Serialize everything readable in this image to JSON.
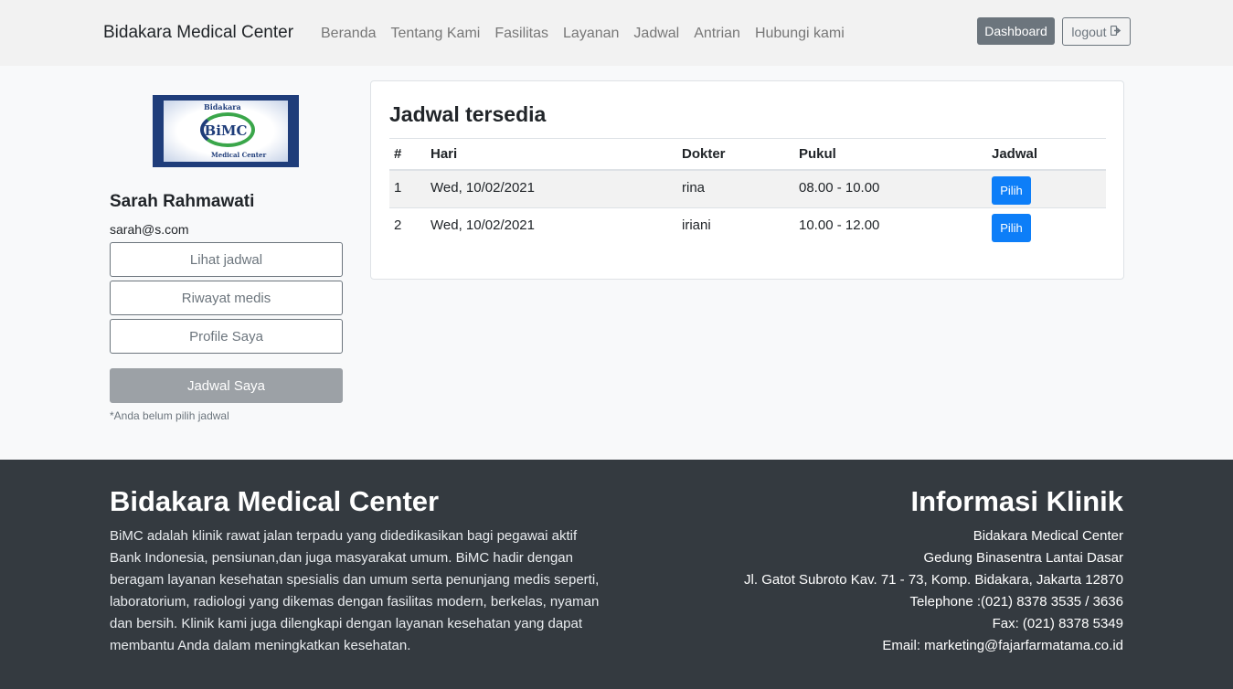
{
  "navbar": {
    "brand": "Bidakara Medical Center",
    "links": [
      "Beranda",
      "Tentang Kami",
      "Fasilitas",
      "Layanan",
      "Jadwal",
      "Antrian",
      "Hubungi kami"
    ],
    "dashboard_label": "Dashboard",
    "logout_label": "logout"
  },
  "logo": {
    "top_text": "Bidakara",
    "mark_text": "BiMC",
    "bottom_text": "Medical Center"
  },
  "sidebar": {
    "user_name": "Sarah Rahmawati",
    "user_email": "sarah@s.com",
    "buttons": [
      "Lihat jadwal",
      "Riwayat medis",
      "Profile Saya"
    ],
    "my_schedule_label": "Jadwal Saya",
    "note": "*Anda belum pilih jadwal"
  },
  "schedule": {
    "title": "Jadwal tersedia",
    "headers": [
      "#",
      "Hari",
      "Dokter",
      "Pukul",
      "Jadwal"
    ],
    "rows": [
      {
        "no": "1",
        "hari": "Wed, 10/02/2021",
        "dokter": "rina",
        "pukul": "08.00 - 10.00",
        "action": "Pilih"
      },
      {
        "no": "2",
        "hari": "Wed, 10/02/2021",
        "dokter": "iriani",
        "pukul": "10.00 - 12.00",
        "action": "Pilih"
      }
    ]
  },
  "footer": {
    "left_title": "Bidakara Medical Center",
    "description": "BiMC adalah klinik rawat jalan terpadu yang didedikasikan bagi pegawai aktif Bank Indonesia, pensiunan,dan juga masyarakat umum. BiMC hadir dengan beragam layanan kesehatan spesialis dan umum serta penunjang medis seperti, laboratorium, radiologi yang dikemas dengan fasilitas modern, berkelas, nyaman dan bersih. Klinik kami juga dilengkapi dengan layanan kesehatan yang dapat membantu Anda dalam meningkatkan kesehatan.",
    "right_title": "Informasi Klinik",
    "info_lines": [
      "Bidakara Medical Center",
      "Gedung Binasentra Lantai Dasar",
      "Jl. Gatot Subroto Kav. 71 - 73, Komp. Bidakara, Jakarta 12870",
      "Telephone :(021) 8378 3535 / 3636",
      "Fax: (021) 8378 5349",
      "Email: marketing@fajarfarmatama.co.id"
    ]
  },
  "colors": {
    "primary": "#0d7ef8",
    "secondary": "#6c757d",
    "footer_bg": "#343a40"
  }
}
